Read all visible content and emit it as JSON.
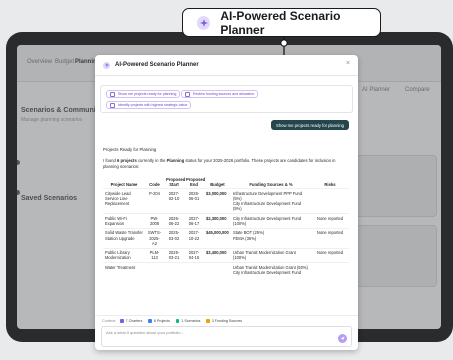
{
  "callout": {
    "title": "AI-Powered Scenario Planner",
    "icon": "sparkle-icon"
  },
  "background": {
    "nav_items": [
      "Overview",
      "Budget",
      "Planning"
    ],
    "actions": [
      "AI Planner",
      "Compare"
    ],
    "section_title": "Scenarios & Community Sessions",
    "section_sub": "Manage planning scenarios",
    "card_title": "Saved Scenarios"
  },
  "modal": {
    "title": "AI-Powered Scenario Planner",
    "close": "×",
    "suggestions": [
      "Show me projects ready for planning",
      "Review funding sources and allocation",
      "Identify projects with highest strategic value"
    ],
    "user_message": "Show me projects ready for planning",
    "reply": {
      "heading": "Projects Ready for Planning",
      "intro_pre": "I found ",
      "intro_count": "6 projects",
      "intro_mid": " currently in the ",
      "intro_status": "Planning",
      "intro_post": " status for your 2025-2026 portfolio. These projects are candidates for inclusion in planning scenarios:"
    },
    "table": {
      "headers": [
        "Project Name",
        "Code",
        "Proposed Start",
        "Proposed End",
        "Budget",
        "Funding Sources & %",
        "Risks"
      ],
      "rows": [
        [
          "Citywide Lead Service Line Replacement",
          "P-204",
          "2027-02-10",
          "2026-06-01",
          "$3,000,000",
          "Infrastructure Development PPP Fund (5%)<br>City Infrastructure Development Fund (5%)",
          ""
        ],
        [
          "Public Wi-Fi Expansion",
          "PW-2008",
          "2026-06-22",
          "2027-06-17",
          "$2,300,000",
          "City Infrastructure Development Fund (100%)",
          "None reported"
        ],
        [
          "Solid Waste Transfer Station Upgrade",
          "SWTS-2025-A2",
          "2025-03-02",
          "2027-10-22",
          "$45,000,000",
          "State BOT (25%)<br>FEMA (35%)",
          "None reported"
        ],
        [
          "Public Library Modernization",
          "PLM-113",
          "2025-03-21",
          "2027-04-15",
          "$3,400,000",
          "Urban Transit Modernization Grant (100%)",
          "None reported"
        ],
        [
          "Water Treatment",
          "",
          "",
          "",
          "",
          "Urban Transit Modernization Grant (50%)<br>City Infrastructure Development Fund",
          ""
        ]
      ]
    },
    "context": {
      "label": "Context:",
      "tags": [
        {
          "text": "7 Charters",
          "color": "#7c5ce0"
        },
        {
          "text": "6 Projects",
          "color": "#3b82f6"
        },
        {
          "text": "1 Scenarios",
          "color": "#10b981"
        },
        {
          "text": "3 Funding Sources",
          "color": "#f59e0b"
        }
      ]
    },
    "input_placeholder": "Ask a what-if question about your portfolio..."
  }
}
